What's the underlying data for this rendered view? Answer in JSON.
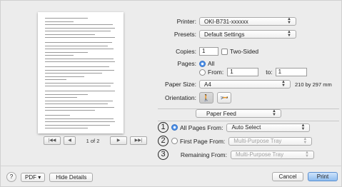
{
  "preview": {
    "page_indicator": "1 of 2",
    "first_label": "|◀◀",
    "prev_label": "◀",
    "next_label": "▶",
    "last_label": "▶▶|"
  },
  "printer": {
    "label": "Printer:",
    "value": "OKI-B731-xxxxxx"
  },
  "presets": {
    "label": "Presets:",
    "value": "Default Settings"
  },
  "copies": {
    "label": "Copies:",
    "value": "1",
    "two_sided_label": "Two-Sided"
  },
  "pages": {
    "label": "Pages:",
    "all_label": "All",
    "from_label": "From:",
    "from_value": "1",
    "to_label": "to:",
    "to_value": "1"
  },
  "paper_size": {
    "label": "Paper Size:",
    "value": "A4",
    "dimensions": "210 by 297 mm"
  },
  "orientation": {
    "label": "Orientation:"
  },
  "section_popup": {
    "value": "Paper Feed"
  },
  "paper_feed": {
    "all_pages_from": {
      "number": "1",
      "label": "All Pages From:",
      "value": "Auto Select"
    },
    "first_page_from": {
      "number": "2",
      "label": "First Page From:",
      "value": "Multi-Purpose Tray"
    },
    "remaining_from": {
      "number": "3",
      "label": "Remaining From:",
      "value": "Multi-Purpose Tray"
    }
  },
  "bottom": {
    "help_label": "?",
    "pdf_label": "PDF ▾",
    "hide_details_label": "Hide Details",
    "cancel_label": "Cancel",
    "print_label": "Print"
  }
}
